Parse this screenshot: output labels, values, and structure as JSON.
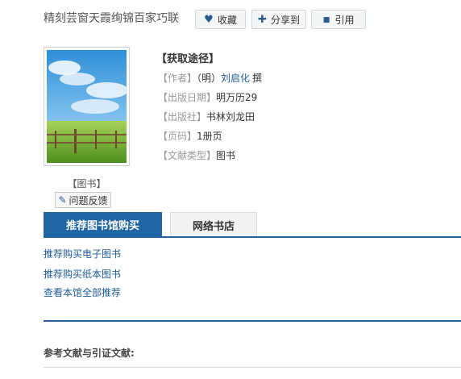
{
  "header": {
    "title": "精刻芸窗天霞绚锦百家巧联",
    "buttons": {
      "favorite": {
        "icon": "heart-icon",
        "label": "收藏"
      },
      "share": {
        "icon": "plus-icon",
        "label": "分享到"
      },
      "cite": {
        "icon": "tag-icon",
        "label": "引用"
      }
    }
  },
  "book": {
    "cover_alt_icon": "book-cover-image",
    "type_label": "【图书】",
    "feedback_label": "问题反馈",
    "access_heading": "【获取途径】",
    "author": {
      "label": "【作者】",
      "dynasty": "（明）",
      "name": "刘启化",
      "role": "撰"
    },
    "publish_date": {
      "label": "【出版日期】",
      "value": "明万历29"
    },
    "publisher": {
      "label": "【出版社】",
      "value": "书林刘龙田"
    },
    "pages": {
      "label": "【页码】",
      "value": "1册页"
    },
    "doc_type": {
      "label": "【文献类型】",
      "value": "图书"
    }
  },
  "tabs": [
    {
      "label": "推荐图书馆购买",
      "active": true
    },
    {
      "label": "网络书店",
      "active": false
    }
  ],
  "links": [
    "推荐购买电子图书",
    "推荐购买纸本图书",
    "查看本馆全部推荐"
  ],
  "references_heading": "参考文献与引证文献:",
  "colors": {
    "accent": "#1f65a3",
    "link": "#1f5c9a"
  }
}
